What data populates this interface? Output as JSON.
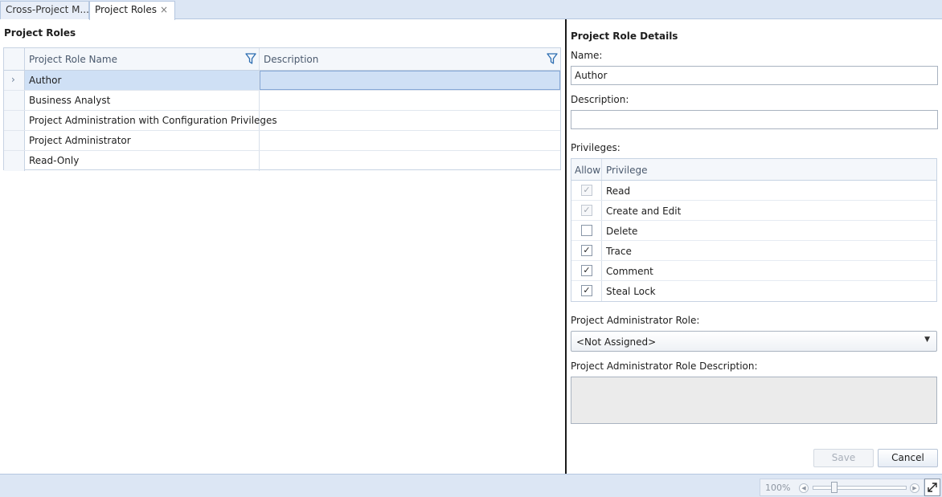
{
  "tabs": [
    {
      "label": "Cross-Project M..."
    },
    {
      "label": "Project Roles",
      "close": "×"
    }
  ],
  "roles_panel": {
    "title": "Project Roles",
    "columns": {
      "name": "Project Role Name",
      "description": "Description"
    },
    "rows": [
      {
        "name": "Author",
        "description": "",
        "selected": true
      },
      {
        "name": "Business Analyst",
        "description": ""
      },
      {
        "name": "Project Administration with Configuration Privileges",
        "description": ""
      },
      {
        "name": "Project Administrator",
        "description": ""
      },
      {
        "name": "Read-Only",
        "description": ""
      }
    ],
    "selected_indicator": "›"
  },
  "details": {
    "title": "Project Role Details",
    "name_label": "Name:",
    "name_value": "Author",
    "description_label": "Description:",
    "description_value": "",
    "privileges_label": "Privileges:",
    "privileges_columns": {
      "allow": "Allow",
      "privilege": "Privilege"
    },
    "privileges": [
      {
        "name": "Read",
        "mark": "✓",
        "disabled": true
      },
      {
        "name": "Create and Edit",
        "mark": "✓",
        "disabled": true
      },
      {
        "name": "Delete",
        "mark": "",
        "disabled": false
      },
      {
        "name": "Trace",
        "mark": "✓",
        "disabled": false
      },
      {
        "name": "Comment",
        "mark": "✓",
        "disabled": false
      },
      {
        "name": "Steal Lock",
        "mark": "✓",
        "disabled": false
      }
    ],
    "admin_role_label": "Project Administrator Role:",
    "admin_role_value": "<Not Assigned>",
    "admin_role_desc_label": "Project Administrator Role Description:",
    "admin_role_desc_value": "",
    "save_label": "Save",
    "cancel_label": "Cancel"
  },
  "statusbar": {
    "zoom": "100%"
  },
  "colors": {
    "accent": "#dce6f4",
    "selected_row": "#cfe0f5",
    "filter_icon": "#2b6cb0"
  }
}
